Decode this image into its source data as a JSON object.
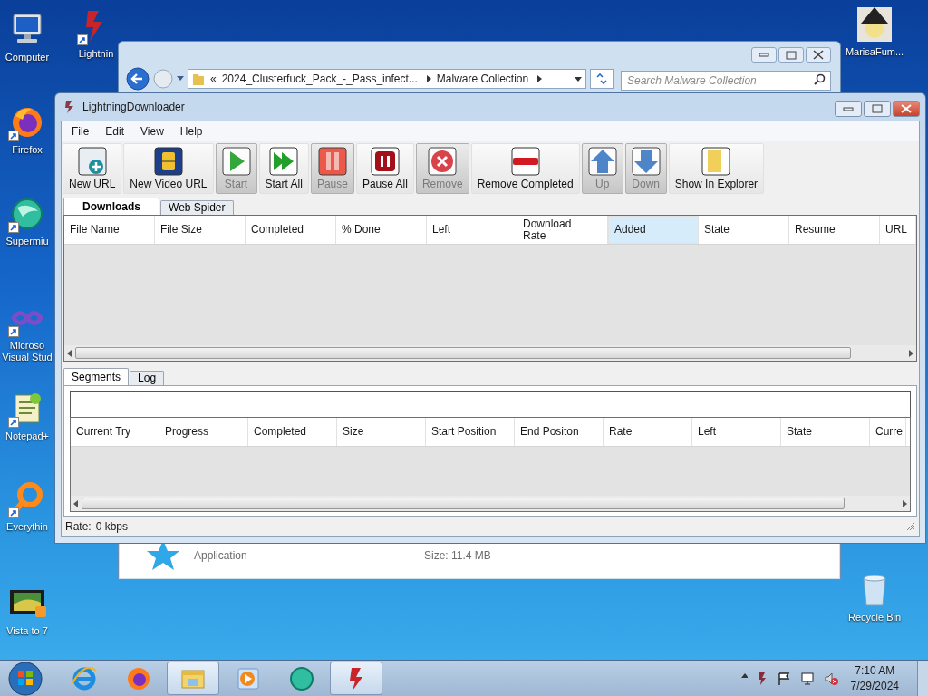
{
  "desktop_icons_left": [
    {
      "label": "Computer",
      "kind": "computer",
      "shortcut": false
    },
    {
      "label": "Firefox",
      "kind": "firefox",
      "shortcut": true
    },
    {
      "label": "Supermiu",
      "kind": "green-ball",
      "shortcut": true
    },
    {
      "label": "Microso\nVisual Stud",
      "kind": "vs",
      "shortcut": true
    },
    {
      "label": "Notepad+",
      "kind": "notepad",
      "shortcut": true
    },
    {
      "label": "Everythin",
      "kind": "everything",
      "shortcut": true
    },
    {
      "label": "Vista to 7",
      "kind": "video",
      "shortcut": false
    }
  ],
  "desktop_icon_top": {
    "label": "Lightnin",
    "kind": "lightning",
    "shortcut": true
  },
  "desktop_icons_right": [
    {
      "label": "MarisaFum...",
      "kind": "avatar"
    },
    {
      "label": "Recycle Bin",
      "kind": "bin"
    }
  ],
  "explorer_window": {
    "path_prefix": "«",
    "path": [
      {
        "label": "2024_Clusterfuck_Pack_-_Pass_infect..."
      },
      {
        "label": "Malware Collection"
      }
    ],
    "search": {
      "placeholder": "Search Malware Collection"
    },
    "file": {
      "type": "Application",
      "size": "Size: 11.4 MB"
    }
  },
  "window": {
    "title": "LightningDownloader",
    "menu": [
      "File",
      "Edit",
      "View",
      "Help"
    ],
    "toolbar": [
      {
        "label": "New URL",
        "kind": "new-url",
        "disabled": false
      },
      {
        "label": "New Video URL",
        "kind": "video",
        "disabled": false
      },
      {
        "label": "Start",
        "kind": "play",
        "disabled": true
      },
      {
        "label": "Start All",
        "kind": "play-all",
        "disabled": false
      },
      {
        "label": "Pause",
        "kind": "pause",
        "disabled": true
      },
      {
        "label": "Pause All",
        "kind": "pause-all",
        "disabled": false
      },
      {
        "label": "Remove",
        "kind": "remove",
        "disabled": true
      },
      {
        "label": "Remove Completed",
        "kind": "remove-completed",
        "disabled": false
      },
      {
        "label": "Up",
        "kind": "up",
        "disabled": true
      },
      {
        "label": "Down",
        "kind": "down",
        "disabled": true
      },
      {
        "label": "Show In Explorer",
        "kind": "folder",
        "disabled": false
      }
    ],
    "tabs": [
      {
        "label": "Downloads",
        "selected": true
      },
      {
        "label": "Web Spider",
        "selected": false
      }
    ],
    "downloads_columns": [
      {
        "label": "File Name",
        "hovered": false
      },
      {
        "label": "File Size",
        "hovered": false
      },
      {
        "label": "Completed",
        "hovered": false
      },
      {
        "label": "% Done",
        "hovered": false
      },
      {
        "label": "Left",
        "hovered": false
      },
      {
        "label": "Download\nRate",
        "hovered": false
      },
      {
        "label": "Added",
        "hovered": true
      },
      {
        "label": "State",
        "hovered": false
      },
      {
        "label": "Resume",
        "hovered": false
      },
      {
        "label": "URL",
        "hovered": false
      }
    ],
    "detail_tabs": [
      {
        "label": "Segments",
        "selected": true
      },
      {
        "label": "Log",
        "selected": false
      }
    ],
    "segments_columns": [
      "Current Try",
      "Progress",
      "Completed",
      "Size",
      "Start Position",
      "End Positon",
      "Rate",
      "Left",
      "State",
      "Curre"
    ],
    "status_bar": {
      "label": "Rate:",
      "value": "0 kbps"
    }
  },
  "taskbar": {
    "items": [
      {
        "kind": "ie",
        "open": false
      },
      {
        "kind": "firefox",
        "open": false
      },
      {
        "kind": "explorer",
        "open": true
      },
      {
        "kind": "media",
        "open": false
      },
      {
        "kind": "green-ball",
        "open": false
      },
      {
        "kind": "lightning",
        "open": true
      }
    ],
    "time": "7:10 AM",
    "date": "7/29/2024"
  }
}
